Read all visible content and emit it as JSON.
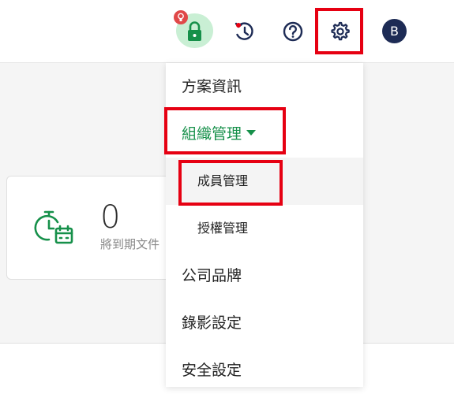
{
  "header": {
    "avatar_initial": "B",
    "icons": {
      "security": "lock-icon",
      "history": "history-icon",
      "help": "help-icon",
      "settings": "gear-icon"
    },
    "colors": {
      "accent_green": "#16904a",
      "avatar_bg": "#1d2b55",
      "highlight_red": "#e60012",
      "badge_red": "#e04848"
    }
  },
  "stat_card": {
    "value": "0",
    "label": "將到期文件"
  },
  "settings_menu": {
    "items": [
      {
        "label": "方案資訊"
      },
      {
        "label": "組織管理"
      },
      {
        "label": "成員管理"
      },
      {
        "label": "授權管理"
      },
      {
        "label": "公司品牌"
      },
      {
        "label": "錄影設定"
      },
      {
        "label": "安全設定"
      }
    ]
  }
}
